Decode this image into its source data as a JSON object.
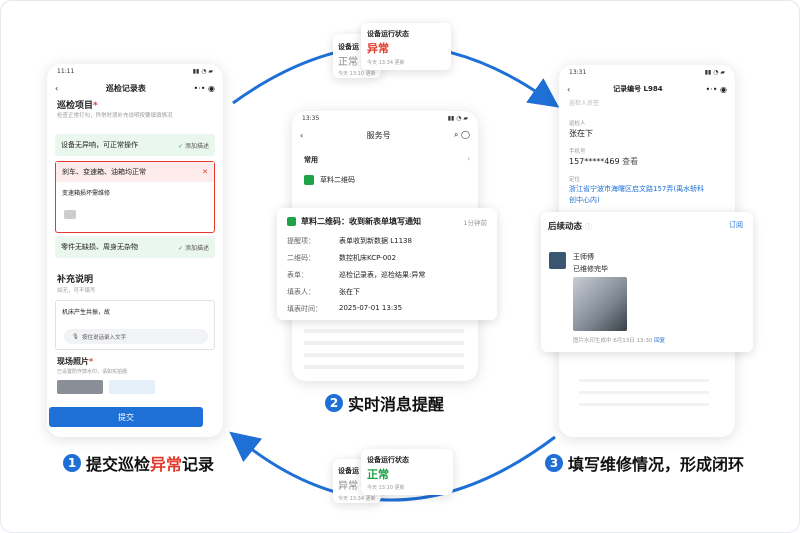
{
  "phone1": {
    "time": "11:11",
    "title": "巡检记录表",
    "section": "巡检项目",
    "hint": "检查正常打勾，异常时须补充说明按要填填情况",
    "item1": "设备无异响，可正常操作",
    "add1": "添加描述",
    "item2": "刹车、变速箱、油箱均正常",
    "item2_note": "变速箱损坏需维修",
    "item3": "零件无缺损、周身无杂物",
    "add3": "添加描述",
    "supp_title": "补充说明",
    "supp_hint": "如无，可不填写",
    "supp_text": "机床产生共振，故",
    "voice": "按住说话录入文字",
    "photo_title": "现场照片",
    "photo_hint": "已设置防作弊水印，请如实拍摄",
    "submit": "提交"
  },
  "phone2": {
    "time": "13:35",
    "title": "服务号",
    "common": "常用",
    "app": "草料二维码"
  },
  "notify": {
    "title": "草料二维码：收到新表单填写通知",
    "time": "1分钟前",
    "rows": [
      {
        "k": "提醒项：",
        "v": "表单收到新数据 L1138"
      },
      {
        "k": "二维码：",
        "v": "数控机床KCP-002"
      },
      {
        "k": "表单：",
        "v": "巡检记录表，巡检结果:异常"
      },
      {
        "k": "填表人：",
        "v": "张在下"
      },
      {
        "k": "填表时间：",
        "v": "2025-07-01 13:35"
      }
    ]
  },
  "phone3": {
    "time": "13:31",
    "title": "记录编号 L984",
    "cut": "巡检人员签",
    "inspector_k": "巡检人",
    "inspector_v": "张在下",
    "phone_k": "手机号",
    "phone_v": "157*****469",
    "view": "查看",
    "addr_k": "定位",
    "addr_v": "浙江省宁波市海曙区启文路157弄(禹水轿科创中心内)"
  },
  "followup": {
    "title": "后续动态",
    "subscribe": "订阅",
    "name": "王师傅",
    "status": "已维修完毕",
    "foot": "图片水印生成中",
    "date": "6月13日 13:30",
    "reply": "回复"
  },
  "status_top": {
    "label": "设备运行状态",
    "value": "异常",
    "time": "今天 13:34 更新",
    "back_label": "设备运",
    "back_value": "正常",
    "back_time": "今天 13:10 更新"
  },
  "status_bottom": {
    "label": "设备运行状态",
    "value": "正常",
    "time": "今天 13:10 更新",
    "back_label": "设备运",
    "back_value": "异常",
    "back_time": "今天 13:34 更新"
  },
  "steps": {
    "s1_num": "1",
    "s1_a": "提交巡检",
    "s1_b": "异常",
    "s1_c": "记录",
    "s2_num": "2",
    "s2": "实时消息提醒",
    "s3_num": "3",
    "s3": "填写维修情况，形成闭环"
  },
  "colors": {
    "accent": "#1e6fd6",
    "red": "#e23b2e",
    "green": "#1fa347"
  }
}
